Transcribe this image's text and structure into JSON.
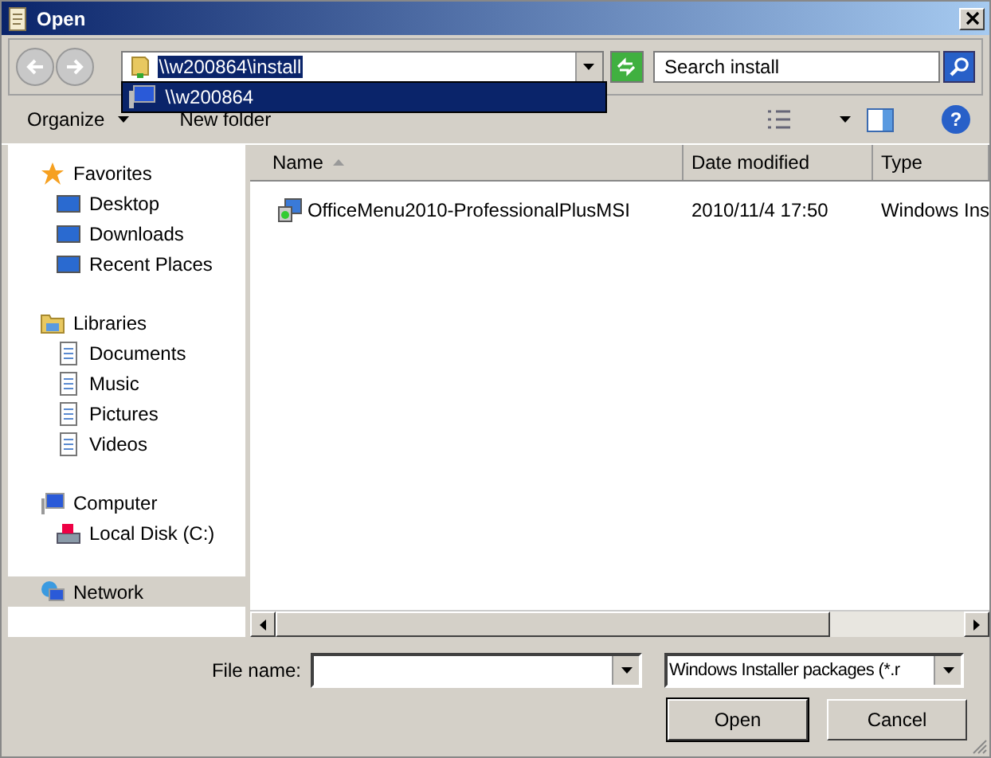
{
  "window": {
    "title": "Open"
  },
  "address": {
    "value": "\\\\w200864\\install",
    "suggestions": [
      {
        "label": "\\\\w200864",
        "selected": true
      }
    ]
  },
  "search": {
    "placeholder": "Search install"
  },
  "toolbar": {
    "organize": "Organize",
    "new_folder": "New folder",
    "help": "?"
  },
  "sidebar": {
    "items": [
      {
        "label": "Favorites",
        "selected": false,
        "children": [
          {
            "label": "Desktop",
            "selected": false
          },
          {
            "label": "Downloads",
            "selected": false
          },
          {
            "label": "Recent Places",
            "selected": false
          }
        ]
      },
      {
        "label": "Libraries",
        "selected": false,
        "children": [
          {
            "label": "Documents",
            "selected": false
          },
          {
            "label": "Music",
            "selected": false
          },
          {
            "label": "Pictures",
            "selected": false
          },
          {
            "label": "Videos",
            "selected": false
          }
        ]
      },
      {
        "label": "Computer",
        "selected": false,
        "children": [
          {
            "label": "Local Disk (C:)",
            "selected": false
          }
        ]
      },
      {
        "label": "Network",
        "selected": true
      }
    ]
  },
  "table": {
    "columns": [
      {
        "label": "Name",
        "sorted": true
      },
      {
        "label": "Date modified",
        "sorted": false
      },
      {
        "label": "Type",
        "sorted": false
      }
    ],
    "rows": [
      {
        "name": "OfficeMenu2010-ProfessionalPlusMSI",
        "date": "2010/11/4 17:50",
        "type": "Windows Ins",
        "selected": false
      }
    ]
  },
  "file_name": {
    "label": "File name:"
  },
  "filter": {
    "value": "Windows Installer packages (*.r"
  },
  "buttons": [
    {
      "label": "Open",
      "default": true
    },
    {
      "label": "Cancel",
      "default": false
    }
  ]
}
